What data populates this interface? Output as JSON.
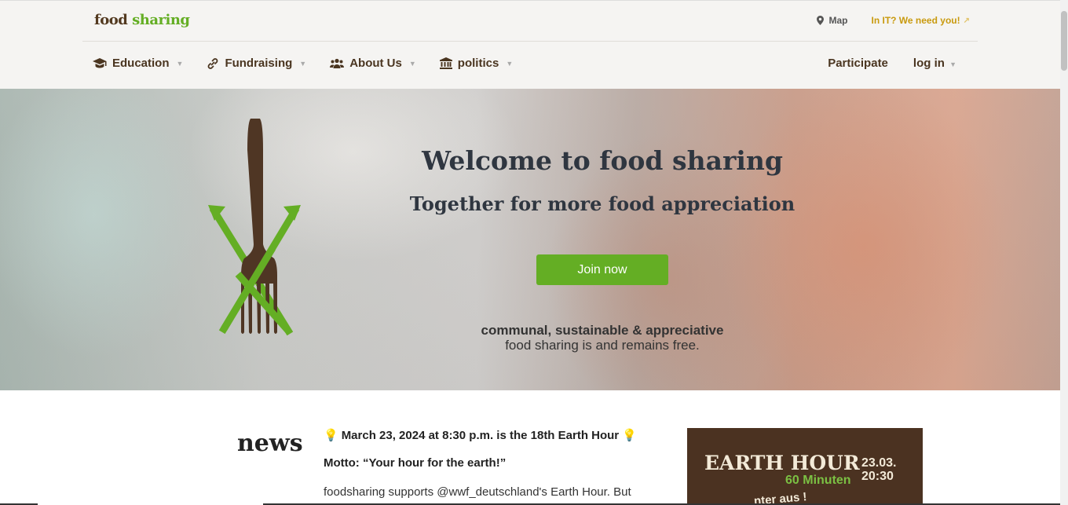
{
  "header": {
    "logo_part1": "food",
    "logo_part2": "sharing",
    "map_label": "Map",
    "it_label": "In IT? We need you!"
  },
  "nav": {
    "items": [
      {
        "label": "Education",
        "icon": "graduation-cap-icon"
      },
      {
        "label": "Fundraising",
        "icon": "link-icon"
      },
      {
        "label": "About Us",
        "icon": "users-icon"
      },
      {
        "label": "politics",
        "icon": "landmark-icon"
      }
    ],
    "participate": "Participate",
    "login": "log in"
  },
  "hero": {
    "title": "Welcome to food sharing",
    "subtitle": "Together for more food appreciation",
    "join_label": "Join now",
    "tagline_bold": "communal, sustainable & appreciative",
    "tagline": "food sharing is and remains free."
  },
  "news": {
    "title": "news",
    "post_head": "March 23, 2024 at 8:30 p.m. is the 18th Earth Hour",
    "motto": "Motto: “Your hour for the earth!”",
    "body": "foodsharing supports @wwf_deutschland's Earth Hour. But since we don't have our own illuminated buildings where we"
  },
  "earth_hour_card": {
    "title": "EARTH HOUR",
    "date": "23.03.",
    "time": "20:30",
    "minutes": "60 Minuten",
    "lower": "nter aus !"
  },
  "colors": {
    "brand_green": "#64ae24",
    "brand_brown": "#533a20",
    "accent_gold": "#c99a0e"
  }
}
